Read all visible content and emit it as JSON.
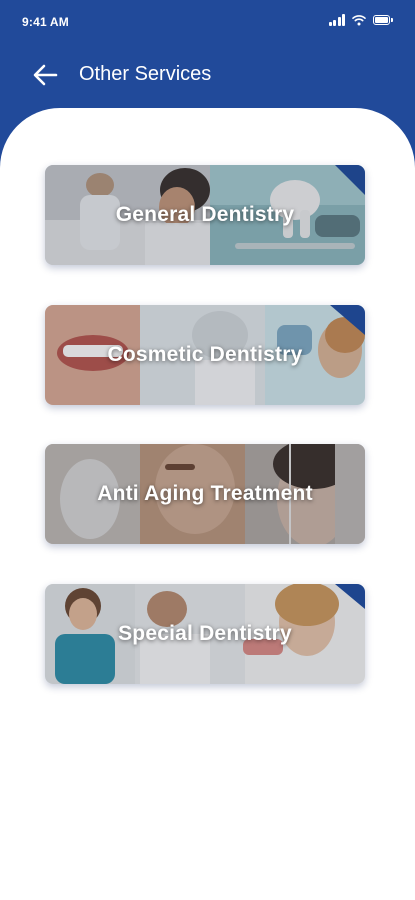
{
  "status_bar": {
    "time": "9:41 AM"
  },
  "header": {
    "title": "Other Services",
    "back_icon": "arrow-left-icon"
  },
  "colors": {
    "primary": "#214a9a",
    "background": "#ffffff",
    "text_on_primary": "#ffffff"
  },
  "services": [
    {
      "label": "General Dentistry"
    },
    {
      "label": "Cosmetic Dentistry"
    },
    {
      "label": "Anti Aging Treatment"
    },
    {
      "label": "Special Dentistry"
    }
  ]
}
